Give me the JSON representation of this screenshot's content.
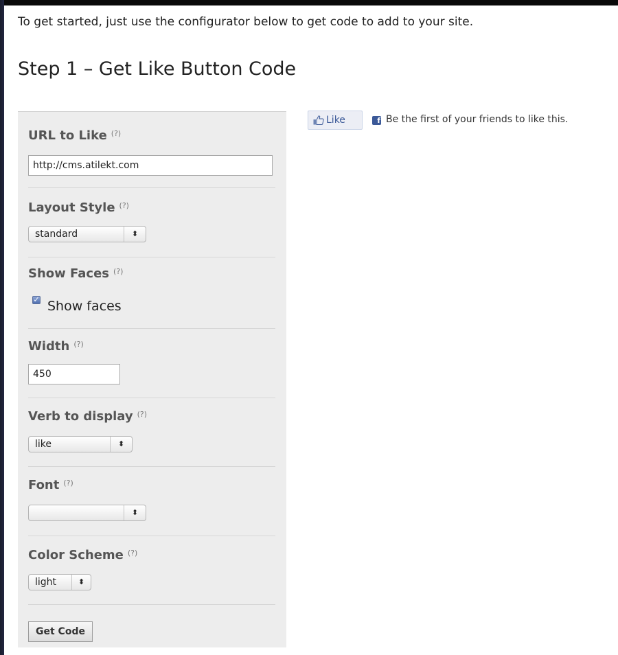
{
  "intro": "To get started, just use the configurator below to get code to add to your site.",
  "step_title": "Step 1 – Get Like Button Code",
  "help_glyph": "(?)",
  "form": {
    "url": {
      "label": "URL to Like",
      "value": "http://cms.atilekt.com"
    },
    "layout": {
      "label": "Layout Style",
      "selected": "standard"
    },
    "faces": {
      "label": "Show Faces",
      "checkbox_label": "Show faces",
      "checked": true
    },
    "width": {
      "label": "Width",
      "value": "450"
    },
    "verb": {
      "label": "Verb to display",
      "selected": "like"
    },
    "font": {
      "label": "Font",
      "selected": ""
    },
    "color": {
      "label": "Color Scheme",
      "selected": "light"
    },
    "submit_label": "Get Code"
  },
  "preview": {
    "like_button_label": "Like",
    "social_text": "Be the first of your friends to like this.",
    "brand_color": "#3b5998",
    "icons": [
      "thumbs-up-icon",
      "facebook-icon"
    ]
  }
}
